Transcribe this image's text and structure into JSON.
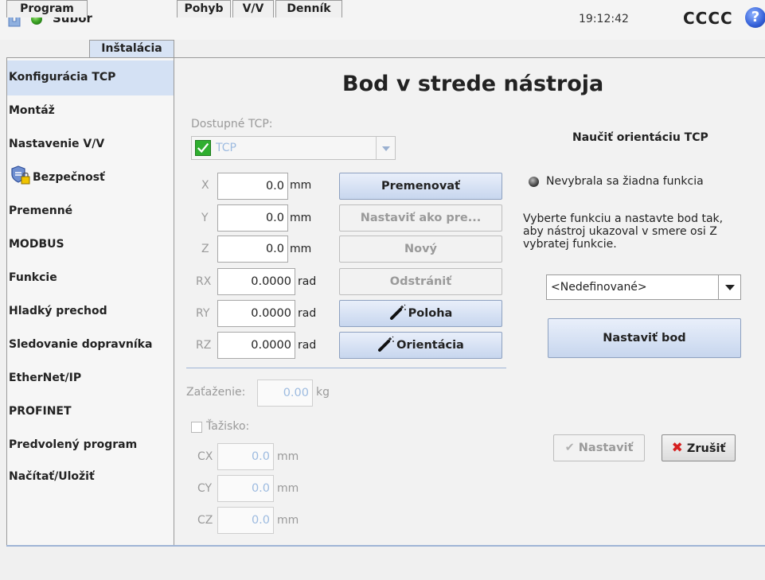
{
  "header": {
    "file_menu": "Súbor",
    "clock": "19:12:42",
    "robot_name": "CCCC",
    "help": "?"
  },
  "tabs": [
    {
      "label": "Program"
    },
    {
      "label": "Inštalácia",
      "active": true
    },
    {
      "label": "Pohyb"
    },
    {
      "label": "V/V"
    },
    {
      "label": "Denník"
    }
  ],
  "sidebar": {
    "items": [
      {
        "label": "Konfigurácia TCP",
        "active": true
      },
      {
        "label": "Montáž"
      },
      {
        "label": "Nastavenie V/V"
      },
      {
        "label": "Bezpečnosť",
        "icon": "shield-lock-icon"
      },
      {
        "label": "Premenné"
      },
      {
        "label": "MODBUS"
      },
      {
        "label": "Funkcie"
      },
      {
        "label": "Hladký prechod"
      },
      {
        "label": "Sledovanie dopravníka"
      },
      {
        "label": "EtherNet/IP"
      },
      {
        "label": "PROFINET"
      },
      {
        "label": "Predvolený program"
      },
      {
        "label": "Načítať/Uložiť"
      }
    ]
  },
  "main": {
    "title": "Bod v strede nástroja",
    "available_tcp_label": "Dostupné TCP:",
    "tcp_select_value": "TCP",
    "pose": [
      {
        "axis": "X",
        "value": "0.0",
        "unit": "mm"
      },
      {
        "axis": "Y",
        "value": "0.0",
        "unit": "mm"
      },
      {
        "axis": "Z",
        "value": "0.0",
        "unit": "mm"
      },
      {
        "axis": "RX",
        "value": "0.0000",
        "unit": "rad"
      },
      {
        "axis": "RY",
        "value": "0.0000",
        "unit": "rad"
      },
      {
        "axis": "RZ",
        "value": "0.0000",
        "unit": "rad"
      }
    ],
    "buttons": {
      "rename": "Premenovať",
      "set_default": "Nastaviť ako pre...",
      "new": "Nový",
      "remove": "Odstrániť",
      "position": "Poloha",
      "orientation": "Orientácia"
    },
    "payload_label": "Zaťaženie:",
    "payload_value": "0.00",
    "payload_unit": "kg",
    "cog_label": "Ťažisko:",
    "cog": [
      {
        "axis": "CX",
        "value": "0.0",
        "unit": "mm"
      },
      {
        "axis": "CY",
        "value": "0.0",
        "unit": "mm"
      },
      {
        "axis": "CZ",
        "value": "0.0",
        "unit": "mm"
      }
    ]
  },
  "teach": {
    "heading": "Naučiť orientáciu TCP",
    "status": "Nevybrala sa žiadna funkcia",
    "instructions": [
      "Vyberte funkciu a nastavte bod tak,",
      "aby nástroj ukazoval v smere osi Z",
      "vybratej funkcie."
    ],
    "feature_select": "<Nedefinované>",
    "set_point": "Nastaviť bod",
    "apply": "Nastaviť",
    "cancel": "Zrušiť"
  },
  "colors": {
    "accent": "#d4e1f4",
    "status_green": "#3ea626",
    "cancel_red": "#d62020"
  }
}
